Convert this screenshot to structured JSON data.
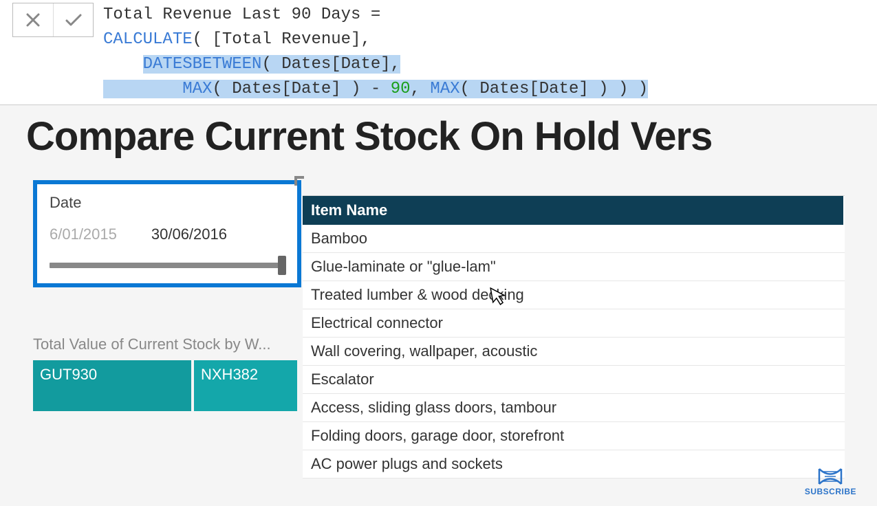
{
  "formula": {
    "line1_plain": "Total Revenue Last 90 Days =",
    "line2_fn": "CALCULATE",
    "line2_rest": "( [Total Revenue],",
    "line3_fn": "DATESBETWEEN",
    "line3_rest": "( Dates[Date],",
    "line4_fn1": "MAX",
    "line4_mid": "( Dates[Date] ) - ",
    "line4_num": "90",
    "line4_sep": ", ",
    "line4_fn2": "MAX",
    "line4_end": "( Dates[Date] ) ) )"
  },
  "report": {
    "title": "Compare Current Stock On Hold Vers"
  },
  "slicer": {
    "label": "Date",
    "start": "6/01/2015",
    "end": "30/06/2016"
  },
  "treemap": {
    "title": "Total Value of Current Stock by W...",
    "tiles": [
      "GUT930",
      "NXH382"
    ]
  },
  "table": {
    "header": "Item Name",
    "rows": [
      "Bamboo",
      "Glue-laminate or \"glue-lam\"",
      "Treated lumber & wood decking",
      "Electrical connector",
      "Wall covering, wallpaper, acoustic",
      "Escalator",
      "Access, sliding glass doors, tambour",
      "Folding doors, garage door, storefront",
      "AC power plugs and sockets"
    ]
  },
  "subscribe": {
    "label": "SUBSCRIBE"
  }
}
